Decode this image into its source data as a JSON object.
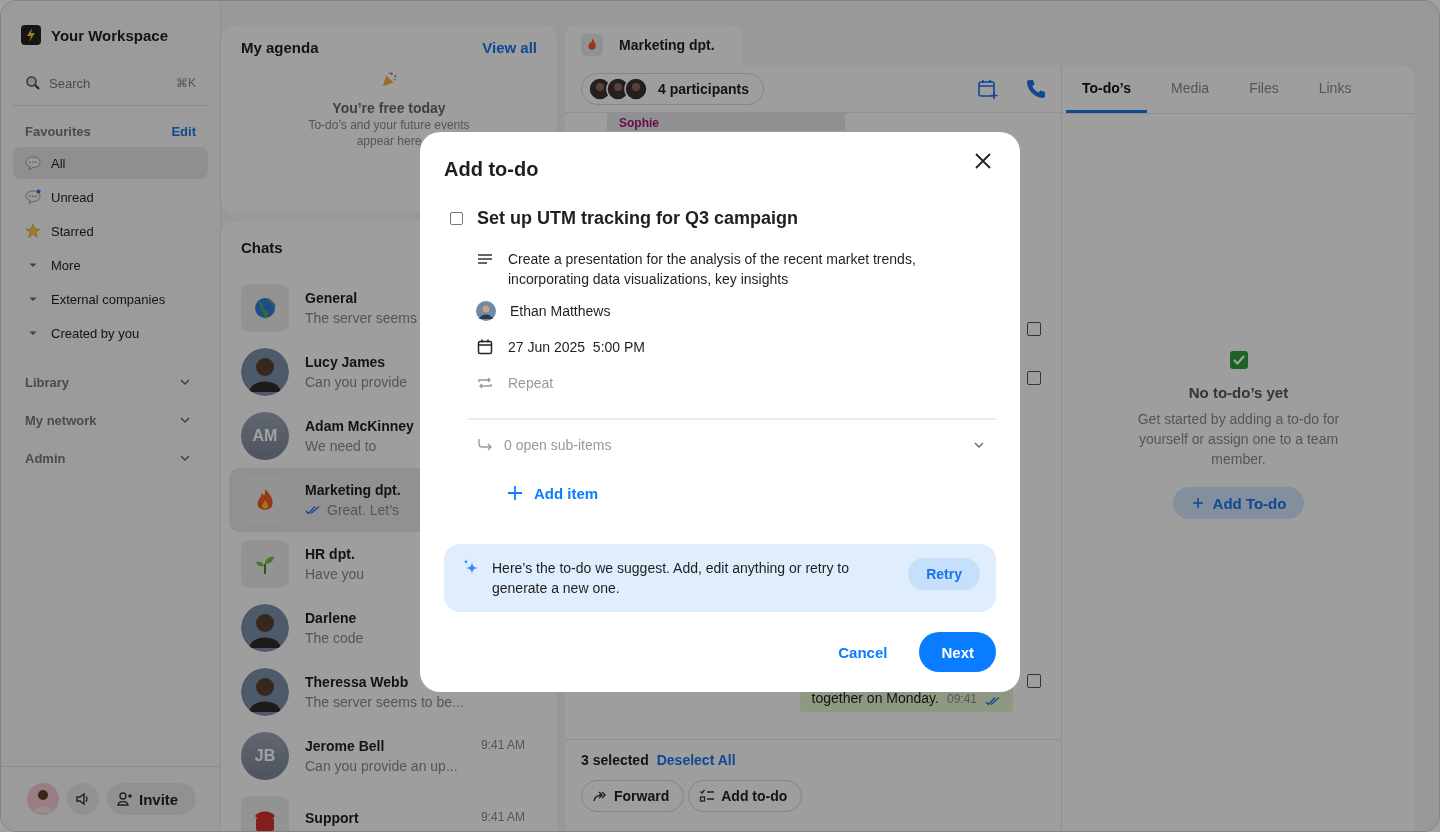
{
  "workspace": {
    "name": "Your Workspace"
  },
  "search": {
    "placeholder": "Search",
    "shortcut": "⌘K"
  },
  "favourites": {
    "title": "Favourites",
    "action": "Edit",
    "items": [
      {
        "label": "All",
        "kind": "chat",
        "selected": true
      },
      {
        "label": "Unread",
        "kind": "unread",
        "selected": false
      },
      {
        "label": "Starred",
        "kind": "star",
        "selected": false
      },
      {
        "label": "More",
        "kind": "group",
        "selected": false
      },
      {
        "label": "External companies",
        "kind": "group",
        "selected": false
      },
      {
        "label": "Created by you",
        "kind": "group",
        "selected": false
      }
    ]
  },
  "sections": [
    {
      "label": "Library"
    },
    {
      "label": "My network"
    },
    {
      "label": "Admin"
    }
  ],
  "footer": {
    "invite": "Invite"
  },
  "agenda": {
    "title": "My agenda",
    "action": "View all",
    "empty_title": "You’re free today",
    "empty_lines": [
      "To-do’s and your future events",
      "appear here"
    ]
  },
  "chats": {
    "title": "Chats",
    "items": [
      {
        "name": "General",
        "preview": "The server seems",
        "kind": "globe",
        "selected": false
      },
      {
        "name": "Lucy James",
        "preview": "Can you provide",
        "kind": "photo",
        "selected": false
      },
      {
        "name": "Adam McKinney",
        "preview": "We need to",
        "kind": "initials",
        "initials": "AM",
        "selected": false
      },
      {
        "name": "Marketing dpt.",
        "preview": "Great. Let’s",
        "kind": "flame",
        "read": true,
        "selected": true
      },
      {
        "name": "HR dpt.",
        "preview": "Have you",
        "kind": "sprout",
        "selected": false
      },
      {
        "name": "Darlene",
        "preview": "The code",
        "kind": "photo",
        "selected": false
      },
      {
        "name": "Theressa Webb",
        "preview": "The server seems to be...",
        "kind": "photo",
        "selected": false
      },
      {
        "name": "Jerome Bell",
        "preview": "Can you provide an up...",
        "time": "9:41 AM",
        "kind": "initials",
        "initials": "JB",
        "selected": false
      },
      {
        "name": "Support",
        "time": "9:41 AM",
        "kind": "phone",
        "selected": false
      }
    ]
  },
  "conversation": {
    "tab": "Marketing dpt.",
    "participants": "4 participants",
    "sender": "Sophie",
    "message": "together on Monday.",
    "time": "09:41",
    "checkboxes": [
      {
        "checked": false
      },
      {
        "checked": false
      },
      {
        "checked": false
      }
    ],
    "selection": {
      "count": "3 selected",
      "action": "Deselect All"
    },
    "actions": [
      {
        "label": "Forward",
        "kind": "forward"
      },
      {
        "label": "Add to-do",
        "kind": "todo"
      }
    ]
  },
  "side_panel": {
    "tabs": [
      {
        "label": "To-do’s",
        "selected": true
      },
      {
        "label": "Media",
        "selected": false
      },
      {
        "label": "Files",
        "selected": false
      },
      {
        "label": "Links",
        "selected": false
      }
    ],
    "empty_title": "No to-do’s yet",
    "empty_text": "Get started by adding a to-do for yourself or assign one to a team member.",
    "button": "Add To-do"
  },
  "dialog": {
    "title": "Add to-do",
    "task": {
      "title": "Set up UTM tracking for Q3 campaign",
      "checked": false
    },
    "description": "Create a presentation for the analysis of the recent market trends, incorporating data visualizations, key insights",
    "assignee": "Ethan Matthews",
    "due": "27 Jun 2025  5:00 PM",
    "repeat": "Repeat",
    "subitems": "0 open sub-items",
    "add_item": "Add item",
    "suggestion": "Here’s the to-do we suggest. Add, edit anything or retry to generate a new one.",
    "retry": "Retry",
    "cancel": "Cancel",
    "next": "Next"
  }
}
